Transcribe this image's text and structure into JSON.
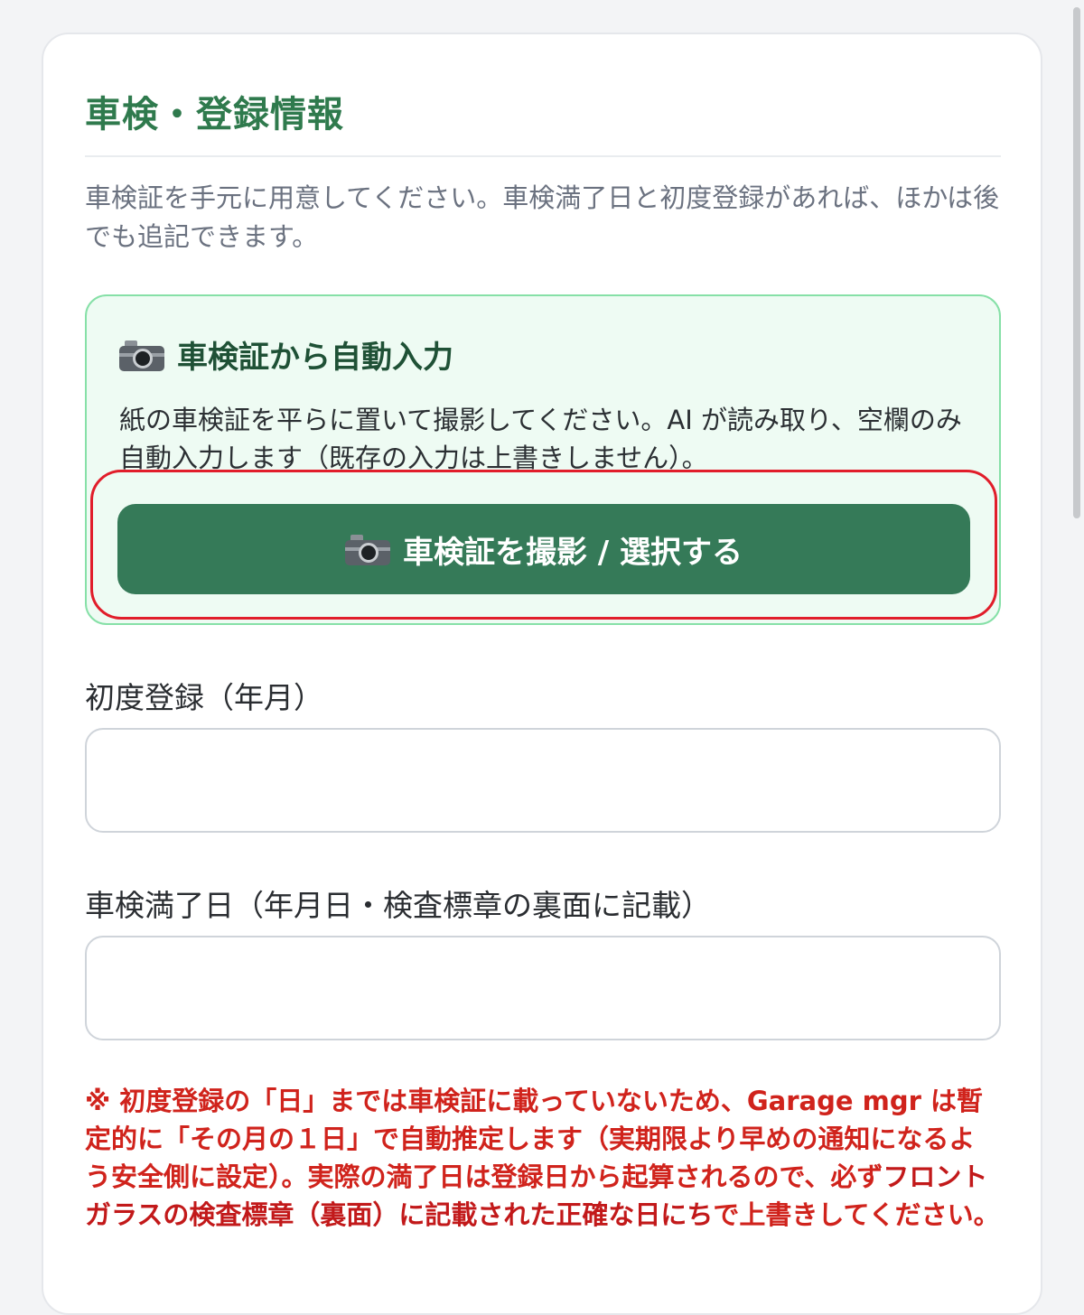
{
  "section": {
    "title": "車検・登録情報",
    "intro": "車検証を手元に用意してください。車検満了日と初度登録があれば、ほかは後でも追記できます。"
  },
  "scan": {
    "icon": "camera-icon",
    "title": "車検証から自動入力",
    "description": "紙の車検証を平らに置いて撮影してください。AI が読み取り、空欄のみ自動入力します（既存の入力は上書きしません）。",
    "button_label": "車検証を撮影 / 選択する",
    "box_bg": "#eefbf3",
    "box_border": "#86e0a7",
    "button_color": "#357a58",
    "highlight_color": "#e11d2a"
  },
  "fields": {
    "first_registration": {
      "label": "初度登録（年月）",
      "value": ""
    },
    "inspection_expiry": {
      "label": "車検満了日（年月日・検査標章の裏面に記載）",
      "value": ""
    }
  },
  "note": {
    "part1": "※ 初度登録の「日」までは車検証に載っていないため、Garage mgr は暫定的に「その月の１日」で自動推定します（実期限より早めの通知になるよう安全側に設定）。実際の満了日は登録日から起算されるので、必ず",
    "part2": "フロントガラスの検査標章（裏面）に記載された正確な日にち",
    "part3": "で上書きしてください。",
    "color": "#d0231c"
  },
  "colors": {
    "title_green": "#2f7a4d",
    "card_bg": "#ffffff",
    "page_bg": "#f3f4f6"
  }
}
